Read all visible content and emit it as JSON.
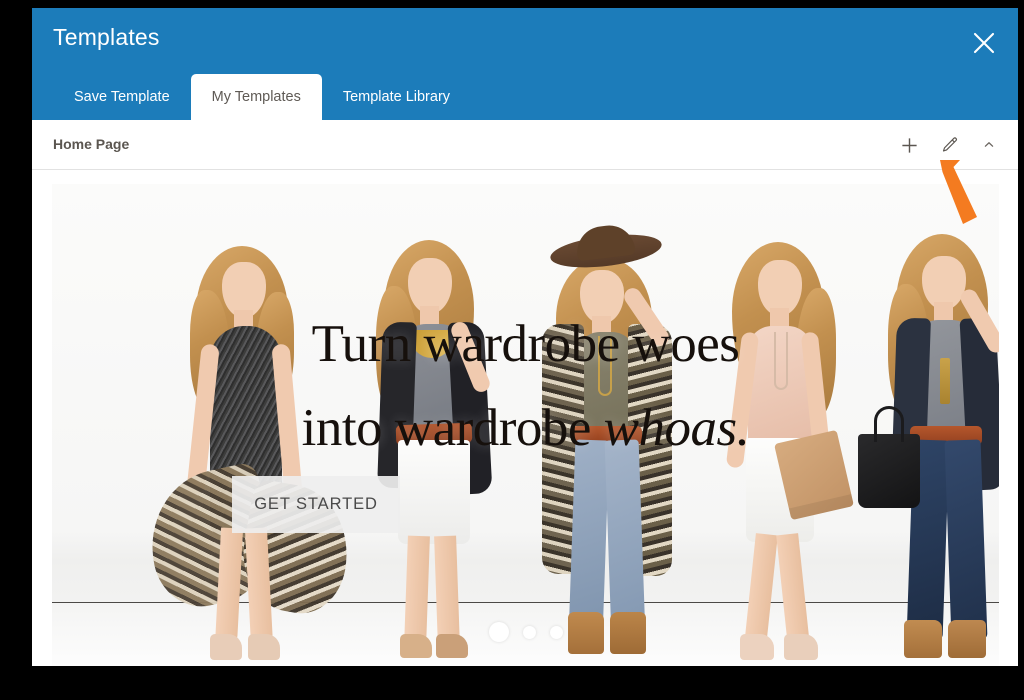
{
  "dialog": {
    "title": "Templates",
    "close_icon": "close-icon",
    "tabs": [
      {
        "label": "Save Template",
        "active": false
      },
      {
        "label": "My Templates",
        "active": true
      },
      {
        "label": "Template Library",
        "active": false
      }
    ],
    "toolbar": {
      "title": "Home Page",
      "actions": [
        {
          "name": "add-template-button",
          "icon": "plus-icon"
        },
        {
          "name": "edit-template-button",
          "icon": "pencil-icon"
        },
        {
          "name": "collapse-button",
          "icon": "chevron-up-icon"
        }
      ]
    }
  },
  "preview": {
    "headline_line1": "Turn wardrobe woes",
    "headline_line2_plain": "into wardrobe ",
    "headline_line2_italic": "whoas.",
    "cta_label": "GET STARTED",
    "carousel": {
      "dots": [
        {
          "active": true
        },
        {
          "active": false
        },
        {
          "active": false
        }
      ]
    }
  },
  "annotation": {
    "arrow_color": "#f47b20",
    "points_to": "edit-template-button"
  },
  "colors": {
    "header_blue": "#1c7cba",
    "tab_active_bg": "#ffffff",
    "tab_active_text": "#5f5a55",
    "toolbar_text": "#5b5650",
    "page_background": "#000000",
    "accent_orange": "#f47b20"
  }
}
